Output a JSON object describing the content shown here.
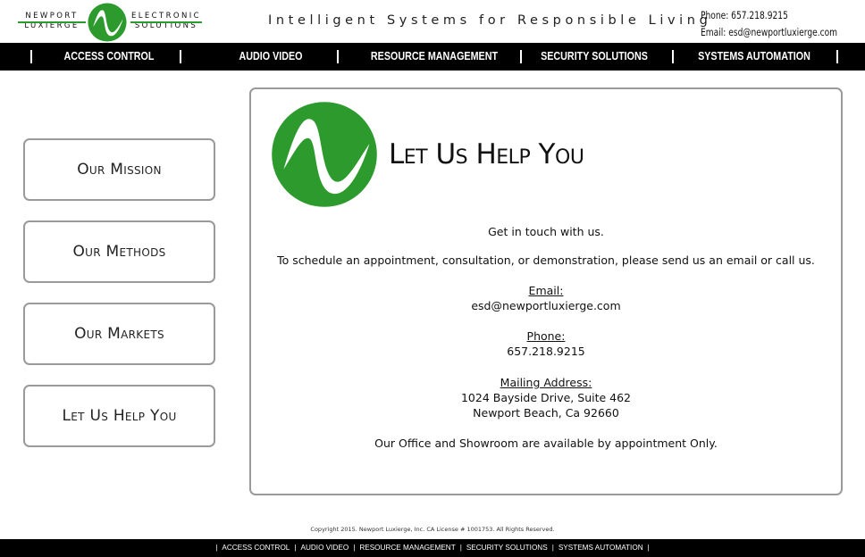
{
  "brand": {
    "word_left_1": "Newport",
    "word_left_2": "Luxierge",
    "word_right_1": "Electronic",
    "word_right_2": "Solutions",
    "accent_color": "#2d9a2d"
  },
  "header": {
    "tagline": "Intelligent Systems for Responsible Living",
    "phone": "Phone: 657.218.9215",
    "email": "Email: esd@newportluxierge.com"
  },
  "nav": {
    "items": [
      {
        "label": "ACCESS CONTROL"
      },
      {
        "label": "AUDIO VIDEO"
      },
      {
        "label": "RESOURCE MANAGEMENT"
      },
      {
        "label": "SECURITY SOLUTIONS"
      },
      {
        "label": "SYSTEMS AUTOMATION"
      }
    ]
  },
  "sidebar": {
    "items": [
      {
        "label": "Our Mission"
      },
      {
        "label": "Our Methods"
      },
      {
        "label": "Our Markets"
      },
      {
        "label": "Let Us Help You"
      }
    ]
  },
  "main": {
    "heading": "Let Us Help You",
    "intro": "Get in touch with us.",
    "instruction": "To schedule an appointment, consultation, or demonstration, please send us an email or call us.",
    "email_label": "Email:",
    "email_value": "esd@newportluxierge.com",
    "phone_label": "Phone:",
    "phone_value": "657.218.9215",
    "address_label": "Mailing Address:",
    "address_line1": "1024 Bayside Drive, Suite 462",
    "address_line2": "Newport Beach, Ca 92660",
    "note": "Our Office and Showroom are available by appointment Only."
  },
  "footer": {
    "copyright": "Copyright 2015. Newport Luxierge, Inc. CA License # 1001753. All Rights Reserved.",
    "separator": "|",
    "nav": [
      {
        "label": "ACCESS CONTROL"
      },
      {
        "label": "AUDIO VIDEO"
      },
      {
        "label": "RESOURCE MANAGEMENT"
      },
      {
        "label": "SECURITY SOLUTIONS"
      },
      {
        "label": "SYSTEMS AUTOMATION"
      }
    ]
  }
}
